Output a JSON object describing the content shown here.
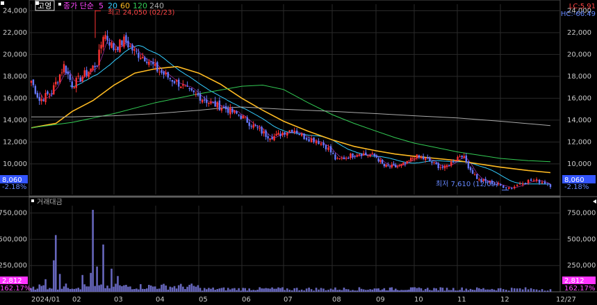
{
  "header": {
    "stock_name": "고영",
    "price_type": "종가 단순",
    "ma_labels": [
      {
        "text": "5",
        "color": "#ff44ff"
      },
      {
        "text": "20",
        "color": "#33ccff"
      },
      {
        "text": "60",
        "color": "#ffbb22"
      },
      {
        "text": "120",
        "color": "#33cc55"
      },
      {
        "text": "240",
        "color": "#aaaaaa"
      }
    ],
    "lc_label": "LC:5.91",
    "hc_label": "HC:-66.49"
  },
  "annotations": {
    "high": "최고 24,050 (02/23)",
    "low": "최저 7,610 (12/09)"
  },
  "price_badge": {
    "value": "8,060",
    "change": "-2.18%"
  },
  "volume_panel": {
    "title": "거래대금",
    "badge_value": "2,812",
    "badge_pct": "162.17%"
  },
  "colors": {
    "up": "#ff3333",
    "down": "#6677ff",
    "ma5": "#ff44ff",
    "ma20": "#33ccff",
    "ma60": "#ffbb22",
    "ma120": "#33cc55",
    "ma240": "#aaaaaa",
    "badge_price": "#3355ff",
    "badge_volume": "#ff33ff",
    "volume": "#6666bb"
  },
  "chart_data": [
    {
      "type": "candlestick",
      "y_ticks": [
        "24,000",
        "22,000",
        "20,000",
        "18,000",
        "16,000",
        "14,000",
        "12,000",
        "10,000"
      ],
      "ylim": [
        7200,
        24600
      ],
      "x_ticks": [
        "2024/01",
        "02",
        "03",
        "04",
        "05",
        "06",
        "07",
        "08",
        "09",
        "10",
        "11",
        "12",
        "12/27"
      ],
      "close_anchors": [
        {
          "m": 0.0,
          "v": 17600
        },
        {
          "m": 0.2,
          "v": 15800
        },
        {
          "m": 0.5,
          "v": 16600
        },
        {
          "m": 0.8,
          "v": 19000
        },
        {
          "m": 1.0,
          "v": 17200
        },
        {
          "m": 1.3,
          "v": 18200
        },
        {
          "m": 1.6,
          "v": 19200
        },
        {
          "m": 1.75,
          "v": 22000
        },
        {
          "m": 2.0,
          "v": 20500
        },
        {
          "m": 2.25,
          "v": 21300
        },
        {
          "m": 2.5,
          "v": 20200
        },
        {
          "m": 2.8,
          "v": 19600
        },
        {
          "m": 3.0,
          "v": 18700
        },
        {
          "m": 3.3,
          "v": 17900
        },
        {
          "m": 3.6,
          "v": 17200
        },
        {
          "m": 3.8,
          "v": 16500
        },
        {
          "m": 4.0,
          "v": 16200
        },
        {
          "m": 4.3,
          "v": 15500
        },
        {
          "m": 4.6,
          "v": 15100
        },
        {
          "m": 4.8,
          "v": 14700
        },
        {
          "m": 5.0,
          "v": 14300
        },
        {
          "m": 5.3,
          "v": 13400
        },
        {
          "m": 5.6,
          "v": 12600
        },
        {
          "m": 5.8,
          "v": 12500
        },
        {
          "m": 6.0,
          "v": 12900
        },
        {
          "m": 6.2,
          "v": 13200
        },
        {
          "m": 6.4,
          "v": 12500
        },
        {
          "m": 6.7,
          "v": 12100
        },
        {
          "m": 6.9,
          "v": 11500
        },
        {
          "m": 7.1,
          "v": 10300
        },
        {
          "m": 7.3,
          "v": 10600
        },
        {
          "m": 7.6,
          "v": 11000
        },
        {
          "m": 8.0,
          "v": 10700
        },
        {
          "m": 8.2,
          "v": 9800
        },
        {
          "m": 8.5,
          "v": 9700
        },
        {
          "m": 8.8,
          "v": 10000
        },
        {
          "m": 9.0,
          "v": 10700
        },
        {
          "m": 9.3,
          "v": 10400
        },
        {
          "m": 9.5,
          "v": 9900
        },
        {
          "m": 9.7,
          "v": 9600
        },
        {
          "m": 9.9,
          "v": 10300
        },
        {
          "m": 10.1,
          "v": 10900
        },
        {
          "m": 10.3,
          "v": 9500
        },
        {
          "m": 10.5,
          "v": 8500
        },
        {
          "m": 10.8,
          "v": 8300
        },
        {
          "m": 11.0,
          "v": 8000
        },
        {
          "m": 11.2,
          "v": 7800
        },
        {
          "m": 11.4,
          "v": 8400
        },
        {
          "m": 11.6,
          "v": 8500
        },
        {
          "m": 11.8,
          "v": 8300
        },
        {
          "m": 11.9,
          "v": 8060
        }
      ],
      "moving_averages": [
        {
          "name": "60",
          "points": [
            [
              0.0,
              13300
            ],
            [
              0.6,
              13700
            ],
            [
              1.0,
              14800
            ],
            [
              1.5,
              15800
            ],
            [
              2.0,
              17200
            ],
            [
              2.5,
              18300
            ],
            [
              3.0,
              18700
            ],
            [
              3.5,
              18900
            ],
            [
              4.0,
              18300
            ],
            [
              4.5,
              17300
            ],
            [
              5.0,
              16000
            ],
            [
              5.5,
              14900
            ],
            [
              6.0,
              13900
            ],
            [
              6.5,
              13000
            ],
            [
              7.0,
              12200
            ],
            [
              7.5,
              11600
            ],
            [
              8.0,
              11200
            ],
            [
              8.5,
              10900
            ],
            [
              9.0,
              10700
            ],
            [
              9.5,
              10500
            ],
            [
              10.0,
              10300
            ],
            [
              10.5,
              10000
            ],
            [
              11.0,
              9700
            ],
            [
              11.5,
              9400
            ],
            [
              11.9,
              9200
            ]
          ]
        },
        {
          "name": "120",
          "points": [
            [
              0.0,
              13300
            ],
            [
              1.0,
              13800
            ],
            [
              2.0,
              14600
            ],
            [
              3.0,
              15600
            ],
            [
              4.0,
              16400
            ],
            [
              5.0,
              17100
            ],
            [
              5.5,
              17200
            ],
            [
              6.0,
              16800
            ],
            [
              6.5,
              15600
            ],
            [
              7.0,
              14500
            ],
            [
              7.5,
              13700
            ],
            [
              8.0,
              13000
            ],
            [
              8.5,
              12400
            ],
            [
              9.0,
              11900
            ],
            [
              9.5,
              11500
            ],
            [
              10.0,
              11100
            ],
            [
              10.5,
              10800
            ],
            [
              11.0,
              10500
            ],
            [
              11.5,
              10300
            ],
            [
              11.9,
              10200
            ]
          ]
        },
        {
          "name": "240",
          "points": [
            [
              0.0,
              14300
            ],
            [
              1.0,
              14300
            ],
            [
              2.0,
              14400
            ],
            [
              3.0,
              14600
            ],
            [
              4.0,
              14900
            ],
            [
              4.5,
              15100
            ],
            [
              5.0,
              15200
            ],
            [
              5.5,
              15100
            ],
            [
              6.0,
              15000
            ],
            [
              7.0,
              14800
            ],
            [
              8.0,
              14600
            ],
            [
              9.0,
              14400
            ],
            [
              10.0,
              14200
            ],
            [
              11.0,
              13900
            ],
            [
              11.9,
              13500
            ]
          ]
        }
      ],
      "high": {
        "m": 1.55,
        "v": 24050
      },
      "low": {
        "m": 11.15,
        "v": 7610
      }
    },
    {
      "type": "bar",
      "title": "거래대금",
      "y_ticks": [
        "750,000",
        "500,000",
        "250,000"
      ],
      "ylim": [
        0,
        820000
      ],
      "spikes": [
        {
          "m": 0.6,
          "v": 540000
        },
        {
          "m": 0.55,
          "v": 300000
        },
        {
          "m": 0.7,
          "v": 170000
        },
        {
          "m": 1.25,
          "v": 160000
        },
        {
          "m": 1.5,
          "v": 780000
        },
        {
          "m": 1.45,
          "v": 180000
        },
        {
          "m": 1.6,
          "v": 240000
        },
        {
          "m": 1.75,
          "v": 450000
        },
        {
          "m": 1.95,
          "v": 220000
        },
        {
          "m": 2.1,
          "v": 150000
        },
        {
          "m": 0.35,
          "v": 120000
        }
      ]
    }
  ]
}
